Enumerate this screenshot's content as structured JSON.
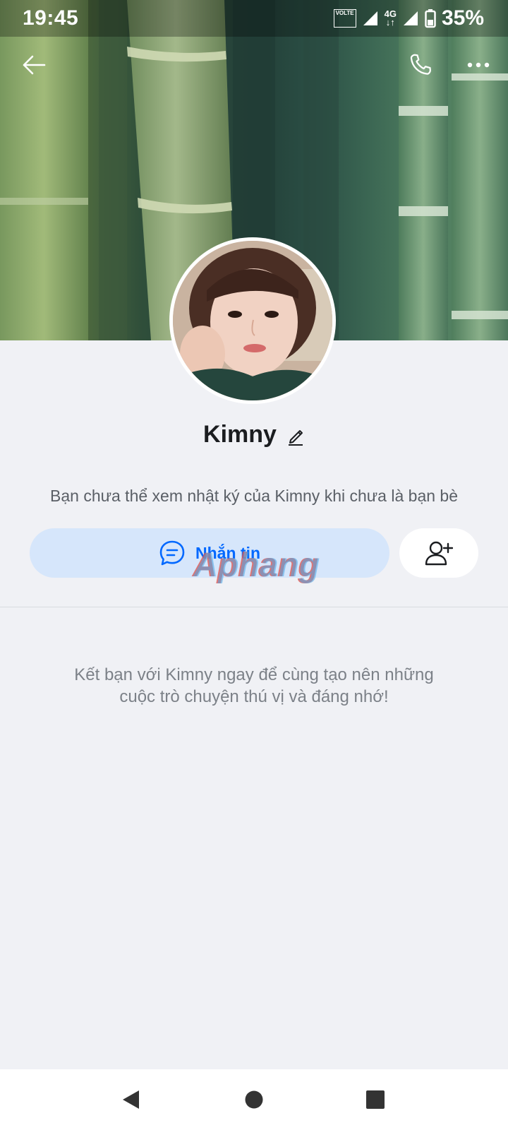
{
  "status_bar": {
    "time": "19:45",
    "volte_label": "VOLTE",
    "network_label": "4G",
    "battery_percent": "35%",
    "icons": [
      "volte-icon",
      "signal-icon",
      "4g-icon",
      "signal-icon",
      "battery-icon"
    ]
  },
  "app_bar": {
    "back_icon": "arrow-left-icon",
    "call_icon": "phone-icon",
    "more_icon": "more-horizontal-icon"
  },
  "profile": {
    "name": "Kimny",
    "edit_icon": "pencil-icon",
    "notice": "Bạn chưa thể xem nhật ký của Kimny khi chưa là bạn bè"
  },
  "actions": {
    "message_label": "Nhắn tin",
    "message_icon": "chat-bubble-icon",
    "add_friend_icon": "add-user-icon"
  },
  "watermark": {
    "text": "Aphang"
  },
  "invite": {
    "line1": "Kết bạn với Kimny ngay để cùng tạo nên những",
    "line2": "cuộc trò chuyện thú vị và đáng nhớ!"
  },
  "nav_bar": {
    "back": "nav-back-icon",
    "home": "nav-home-icon",
    "recents": "nav-recents-icon"
  },
  "colors": {
    "accent": "#0068ff",
    "message_button_bg": "#d6e6fb",
    "background": "#f0f1f5"
  }
}
